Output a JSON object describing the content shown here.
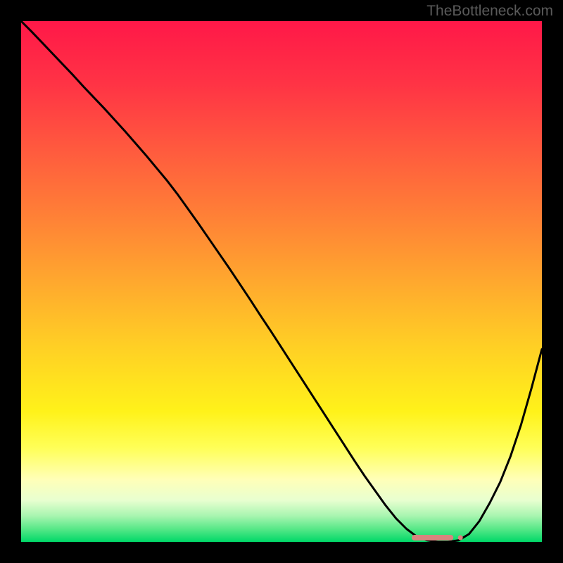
{
  "watermark": "TheBottleneck.com",
  "chart_data": {
    "type": "line",
    "title": "",
    "xlabel": "",
    "ylabel": "",
    "x": [
      0.0,
      0.02,
      0.04,
      0.06,
      0.08,
      0.1,
      0.12,
      0.14,
      0.16,
      0.18,
      0.2,
      0.22,
      0.24,
      0.26,
      0.28,
      0.3,
      0.32,
      0.34,
      0.36,
      0.38,
      0.4,
      0.42,
      0.44,
      0.46,
      0.48,
      0.5,
      0.52,
      0.54,
      0.56,
      0.58,
      0.6,
      0.62,
      0.64,
      0.66,
      0.68,
      0.7,
      0.72,
      0.74,
      0.76,
      0.78,
      0.8,
      0.82,
      0.84,
      0.86,
      0.88,
      0.9,
      0.92,
      0.94,
      0.96,
      0.98,
      1.0
    ],
    "values": [
      1.0,
      0.98,
      0.959,
      0.938,
      0.917,
      0.896,
      0.874,
      0.853,
      0.832,
      0.81,
      0.788,
      0.765,
      0.742,
      0.718,
      0.694,
      0.668,
      0.64,
      0.612,
      0.583,
      0.554,
      0.525,
      0.495,
      0.465,
      0.434,
      0.404,
      0.373,
      0.342,
      0.311,
      0.28,
      0.249,
      0.218,
      0.187,
      0.156,
      0.126,
      0.098,
      0.07,
      0.045,
      0.025,
      0.01,
      0.003,
      0.0,
      0.0,
      0.003,
      0.015,
      0.04,
      0.075,
      0.115,
      0.165,
      0.225,
      0.295,
      0.37
    ],
    "xlim": [
      0,
      1
    ],
    "ylim": [
      0,
      1
    ],
    "marker": {
      "x_start": 0.75,
      "x_end": 0.83,
      "color": "#d8847e"
    },
    "gradient_stops": [
      {
        "offset": 0.0,
        "color": "#ff1848"
      },
      {
        "offset": 0.12,
        "color": "#ff3345"
      },
      {
        "offset": 0.25,
        "color": "#ff5b3e"
      },
      {
        "offset": 0.38,
        "color": "#ff8236"
      },
      {
        "offset": 0.5,
        "color": "#ffa82e"
      },
      {
        "offset": 0.62,
        "color": "#ffce25"
      },
      {
        "offset": 0.75,
        "color": "#fff21a"
      },
      {
        "offset": 0.82,
        "color": "#ffff58"
      },
      {
        "offset": 0.88,
        "color": "#ffffb8"
      },
      {
        "offset": 0.92,
        "color": "#e8ffd0"
      },
      {
        "offset": 0.95,
        "color": "#a8f5b0"
      },
      {
        "offset": 0.975,
        "color": "#58e888"
      },
      {
        "offset": 1.0,
        "color": "#00d868"
      }
    ]
  }
}
